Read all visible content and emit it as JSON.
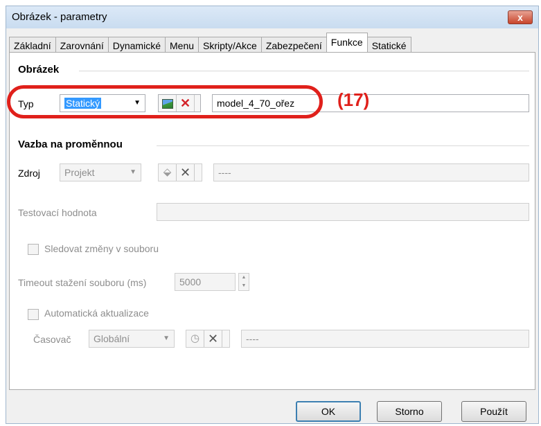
{
  "window": {
    "title": "Obrázek - parametry",
    "close_glyph": "x"
  },
  "tabs": [
    {
      "label": "Základní"
    },
    {
      "label": "Zarovnání"
    },
    {
      "label": "Dynamické"
    },
    {
      "label": "Menu"
    },
    {
      "label": "Skripty/Akce"
    },
    {
      "label": "Zabezpečení"
    },
    {
      "label": "Funkce",
      "active": true
    },
    {
      "label": "Statické"
    }
  ],
  "obrazek": {
    "group_title": "Obrázek",
    "typ_label": "Typ",
    "typ_value": "Statický",
    "file_value": "model_4_70_ořez",
    "annotation": "(17)"
  },
  "vazba": {
    "group_title": "Vazba na proměnnou",
    "zdroj_label": "Zdroj",
    "zdroj_value": "Projekt",
    "zdroj_field": "----",
    "test_label": "Testovací hodnota",
    "test_value": ""
  },
  "sledovat": {
    "label": "Sledovat změny v souboru",
    "checked": false
  },
  "timeout": {
    "label": "Timeout stažení souboru (ms)",
    "value": "5000"
  },
  "auto": {
    "label": "Automatická aktualizace",
    "checked": false,
    "casovac_label": "Časovač",
    "casovac_value": "Globální",
    "casovac_field": "----"
  },
  "buttons": {
    "ok": "OK",
    "storno": "Storno",
    "pouzit": "Použít"
  },
  "colors": {
    "annotation": "#e0201b",
    "selection": "#3399ff"
  }
}
